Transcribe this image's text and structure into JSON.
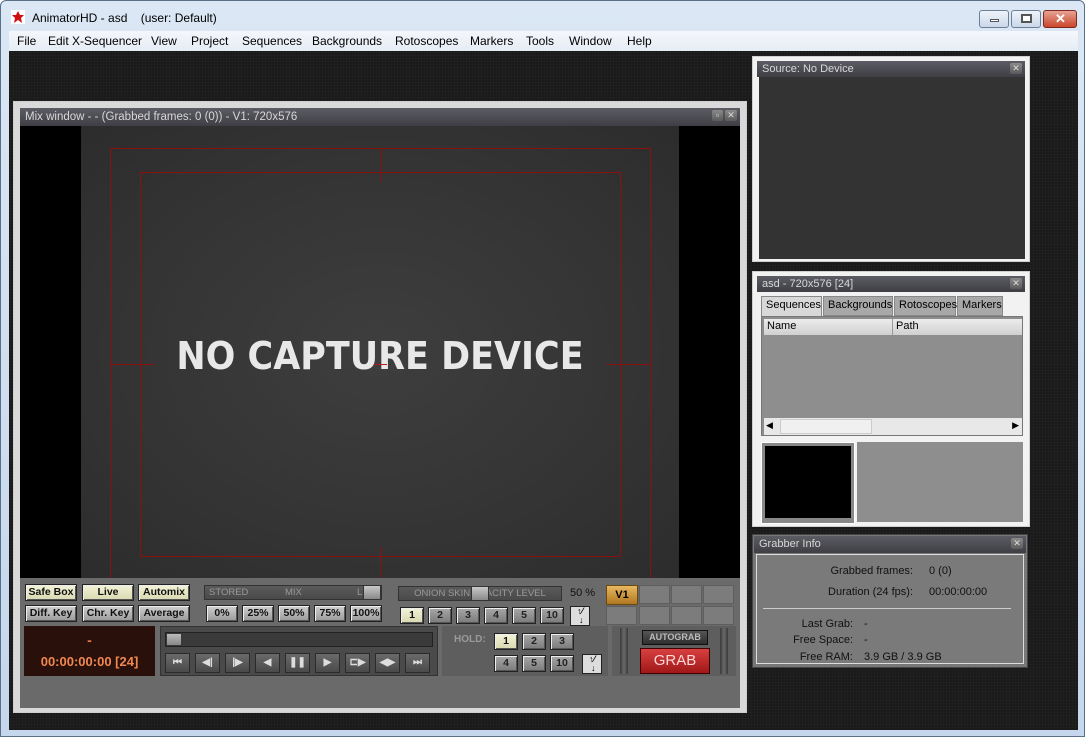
{
  "window": {
    "title": "AnimatorHD - asd",
    "user": "(user: Default)",
    "controls": {
      "minimize": "—",
      "maximize": "□",
      "close": "✕"
    }
  },
  "menu": [
    "File",
    "Edit X-Sequencer",
    "View",
    "Project",
    "Sequences",
    "Backgrounds",
    "Rotoscopes",
    "Markers",
    "Tools",
    "Window",
    "Help"
  ],
  "mix_window": {
    "title": "Mix window - - (Grabbed frames: 0 (0)) - V1: 720x576",
    "overlay_text": "NO CAPTURE DEVICE",
    "mode_buttons": [
      "Safe Box",
      "Live",
      "Automix",
      "Diff. Key",
      "Chr. Key",
      "Average"
    ],
    "mix_slider": {
      "left_label": "STORED",
      "center_label": "MIX",
      "right_label": "LIVE",
      "value": 1.0
    },
    "mix_presets": [
      "0%",
      "25%",
      "50%",
      "75%",
      "100%"
    ],
    "onion_slider": {
      "label": "ONION SKIN OPACITY LEVEL",
      "value_text": "50 %",
      "value": 0.5
    },
    "onion_frames": [
      "1",
      "2",
      "3",
      "4",
      "5",
      "10"
    ],
    "onion_selected": "1",
    "layer_label": "V1",
    "timecode_dash": "-",
    "timecode": "00:00:00:00 [24]",
    "transport_buttons": [
      {
        "name": "go-to-start",
        "glyph": "⏮"
      },
      {
        "name": "step-back",
        "glyph": "◀|"
      },
      {
        "name": "step-forward",
        "glyph": "|▶"
      },
      {
        "name": "play-reverse",
        "glyph": "◀"
      },
      {
        "name": "pause",
        "glyph": "❚❚"
      },
      {
        "name": "play",
        "glyph": "▶"
      },
      {
        "name": "loop",
        "glyph": "⊏▶"
      },
      {
        "name": "ping-pong",
        "glyph": "◀▶"
      },
      {
        "name": "go-to-end",
        "glyph": "⏭"
      }
    ],
    "hold_label": "HOLD:",
    "hold_values": [
      "1",
      "2",
      "3",
      "4",
      "5",
      "10"
    ],
    "hold_selected": "1",
    "autograb_label": "AUTOGRAB",
    "grab_label": "GRAB"
  },
  "source_panel": {
    "title": "Source: No Device"
  },
  "sequence_panel": {
    "title": "asd - 720x576 [24]",
    "tabs": [
      "Sequences",
      "Backgrounds",
      "Rotoscopes",
      "Markers"
    ],
    "active_tab": "Sequences",
    "columns": [
      "Name",
      "Path"
    ],
    "rows": []
  },
  "grabber_info": {
    "title": "Grabber Info",
    "grabbed_frames_label": "Grabbed frames:",
    "grabbed_frames": "0 (0)",
    "duration_label": "Duration (24 fps):",
    "duration": "00:00:00:00",
    "last_grab_label": "Last Grab:",
    "last_grab": "-",
    "free_space_label": "Free Space:",
    "free_space": "-",
    "free_ram_label": "Free RAM:",
    "free_ram": "3.9 GB / 3.9 GB"
  },
  "colors": {
    "accent_red": "#b81c1c",
    "timecode": "#f08850",
    "safe_box": "#8b1111"
  }
}
